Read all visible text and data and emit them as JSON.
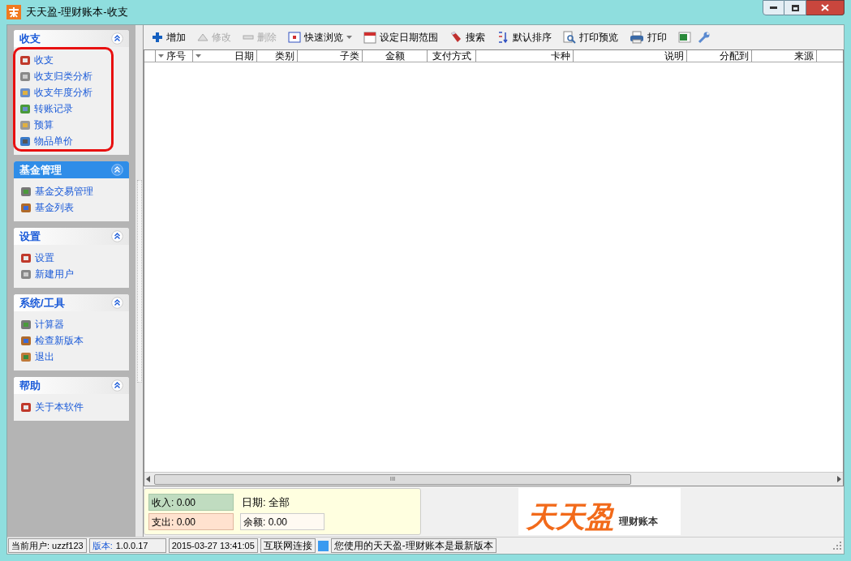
{
  "window": {
    "title": "天天盈-理财账本-收支"
  },
  "sidebar": {
    "sections": [
      {
        "title": "收支",
        "selected": false,
        "circled": true,
        "items": [
          "收支",
          "收支归类分析",
          "收支年度分析",
          "转账记录",
          "预算",
          "物品单价"
        ]
      },
      {
        "title": "基金管理",
        "selected": true,
        "circled": false,
        "items": [
          "基金交易管理",
          "基金列表"
        ]
      },
      {
        "title": "设置",
        "selected": false,
        "circled": false,
        "items": [
          "设置",
          "新建用户"
        ]
      },
      {
        "title": "系统/工具",
        "selected": false,
        "circled": false,
        "items": [
          "计算器",
          "检查新版本",
          "退出"
        ]
      },
      {
        "title": "帮助",
        "selected": false,
        "circled": false,
        "items": [
          "关于本软件"
        ]
      }
    ]
  },
  "toolbar": [
    {
      "label": "增加",
      "disabled": false,
      "dropdown": false
    },
    {
      "label": "修改",
      "disabled": true,
      "dropdown": false
    },
    {
      "label": "删除",
      "disabled": true,
      "dropdown": false
    },
    {
      "label": "快速浏览",
      "disabled": false,
      "dropdown": true
    },
    {
      "label": "设定日期范围",
      "disabled": false,
      "dropdown": false
    },
    {
      "label": "搜索",
      "disabled": false,
      "dropdown": false
    },
    {
      "label": "默认排序",
      "disabled": false,
      "dropdown": false
    },
    {
      "label": "打印预览",
      "disabled": false,
      "dropdown": false
    },
    {
      "label": "打印",
      "disabled": false,
      "dropdown": false
    }
  ],
  "table": {
    "columns": [
      {
        "label": "序号",
        "filter": true
      },
      {
        "label": "日期",
        "filter": true
      },
      {
        "label": "类别",
        "filter": false
      },
      {
        "label": "子类",
        "filter": false
      },
      {
        "label": "金额",
        "filter": false
      },
      {
        "label": "支付方式",
        "filter": false
      },
      {
        "label": "卡种",
        "filter": false
      },
      {
        "label": "说明",
        "filter": false
      },
      {
        "label": "分配到",
        "filter": false
      },
      {
        "label": "来源",
        "filter": false
      }
    ],
    "scroll_grip": "III"
  },
  "summary": {
    "income": "收入: 0.00",
    "expense": "支出: 0.00",
    "date": "日期: 全部",
    "balance": "余额: 0.00"
  },
  "logo": {
    "name": "天天盈",
    "subtitle": "理财账本"
  },
  "status_bar": {
    "user": "当前用户: uzzf123",
    "version_label": "版本:",
    "version": "1.0.0.17",
    "datetime": "2015-03-27 13:41:05",
    "connection": "互联网连接",
    "message": "您使用的天天盈-理财账本是最新版本"
  }
}
